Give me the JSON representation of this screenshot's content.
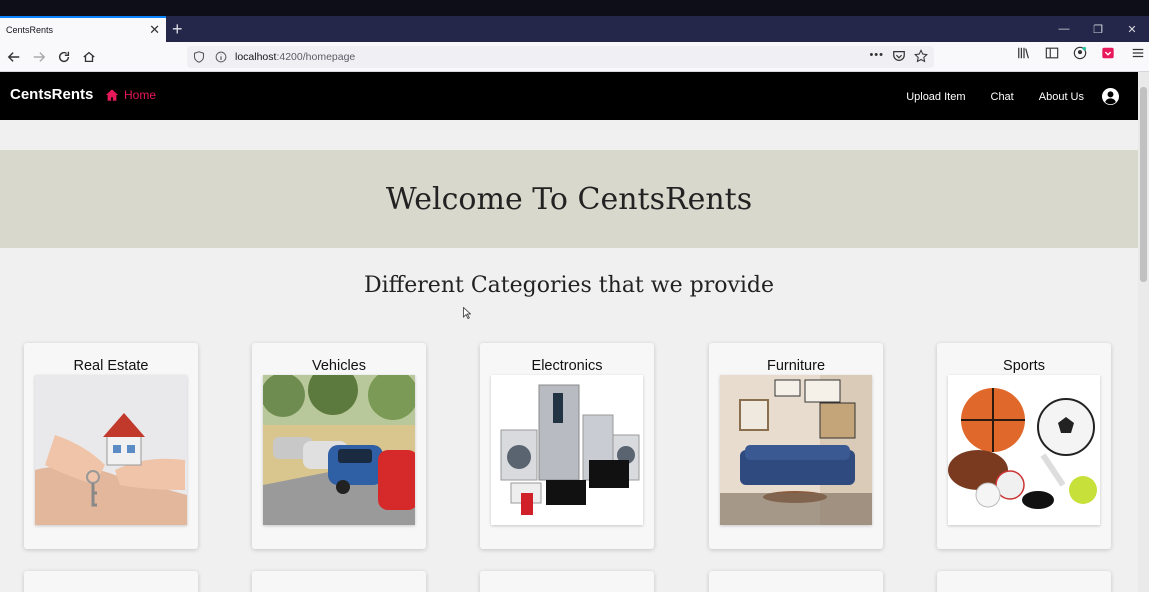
{
  "browser": {
    "tab_title": "CentsRents",
    "url_host": "localhost",
    "url_path": ":4200/homepage"
  },
  "app": {
    "brand": "CentsRents",
    "home_label": "Home",
    "nav": [
      "Upload Item",
      "Chat",
      "About Us"
    ],
    "accent_color": "#e8195a"
  },
  "hero": {
    "title": "Welcome To CentsRents"
  },
  "categories_heading": "Different Categories that we provide",
  "categories": [
    {
      "label": "Real Estate",
      "icon": "house-keys-image"
    },
    {
      "label": "Vehicles",
      "icon": "cars-image"
    },
    {
      "label": "Electronics",
      "icon": "appliances-image"
    },
    {
      "label": "Furniture",
      "icon": "living-room-image"
    },
    {
      "label": "Sports",
      "icon": "sports-balls-image"
    }
  ]
}
